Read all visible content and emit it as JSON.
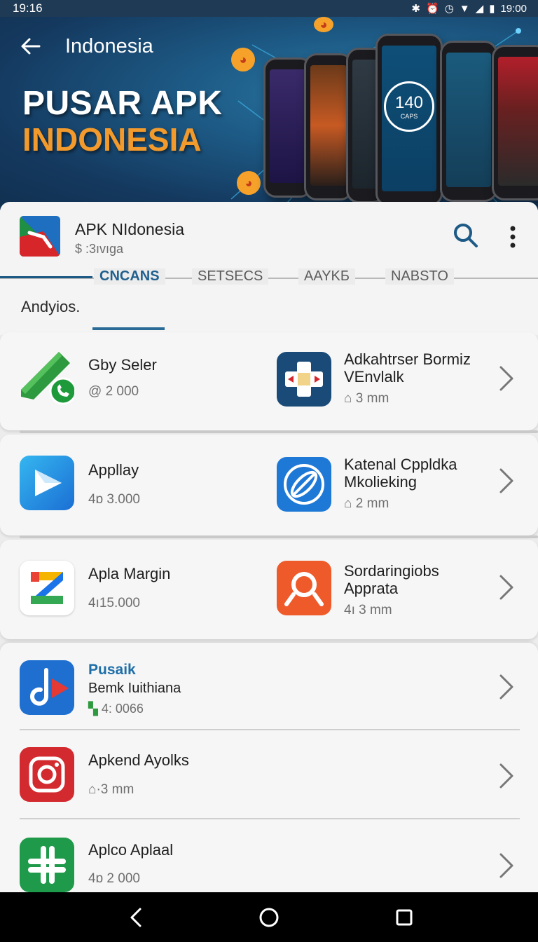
{
  "status_bar": {
    "time": "19:16",
    "right_time": "19:00",
    "icons": [
      "bluetooth-icon",
      "alarm-icon",
      "timer-icon",
      "wifi-icon",
      "signal-icon",
      "battery-icon"
    ]
  },
  "hero": {
    "title": "Indonesia",
    "headline_1": "PUSAR APK",
    "headline_2": "INDONESIA",
    "phone_clock": "140",
    "phone_clock_sub": "CAPS"
  },
  "app_header": {
    "name": "APK NIdonesia",
    "subtitle": "$ :3ıvıga"
  },
  "tabs": [
    {
      "label": "CNCANS",
      "active": true
    },
    {
      "label": "SETSECS",
      "active": false
    },
    {
      "label": "AAYKБ",
      "active": false
    },
    {
      "label": "NABSTO",
      "active": false
    }
  ],
  "section_label": "Andyios.",
  "grid_rows": [
    {
      "left": {
        "title": "Gby Seler",
        "meta": "@ 2 000",
        "icon": "phone-call-app-icon"
      },
      "right": {
        "title": "Adkahtrser Bormiz VEnvlalk",
        "meta": "3 mm",
        "icon": "dpad-app-icon"
      }
    },
    {
      "left": {
        "title": "Appllay",
        "meta": "4ɒ 3.000",
        "icon": "play-store-app-icon"
      },
      "right": {
        "title": "Katenal Cppldka Mkolieking",
        "meta": "2 mm",
        "icon": "link-app-icon"
      }
    },
    {
      "left": {
        "title": "Apla Margin",
        "meta": "4ı15.000",
        "icon": "z-letter-app-icon"
      },
      "right": {
        "title": "Sordaringiobs Apprata",
        "meta": "4ı 3 mm",
        "icon": "search-magnifier-app-icon"
      }
    }
  ],
  "list_items": [
    {
      "category": "Pusaik",
      "title": "Bemk Iuithiana",
      "meta": "4: 0066",
      "icon": "music-note-app-icon"
    },
    {
      "title": "Apkend Ayolks",
      "meta": "·3 mm",
      "icon": "instagram-app-icon"
    },
    {
      "title": "Aplco Aplaal",
      "meta": "4ɒ 2 000",
      "icon": "slack-app-icon"
    }
  ],
  "colors": {
    "accent": "#1d5a86",
    "hero_orange": "#f39a2c",
    "status_bar": "#1f3a55"
  }
}
